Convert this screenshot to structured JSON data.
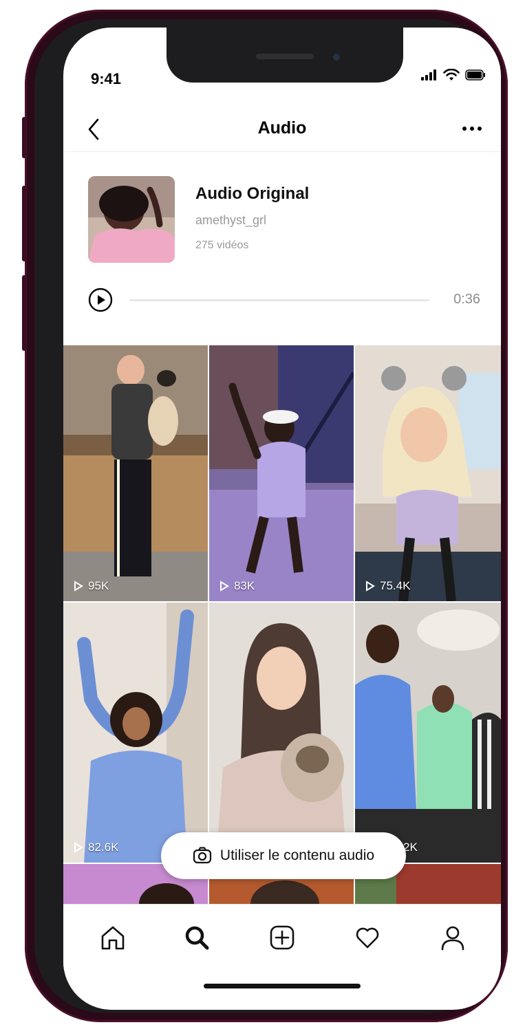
{
  "status_bar": {
    "time": "9:41"
  },
  "nav": {
    "title": "Audio"
  },
  "audio": {
    "title": "Audio Original",
    "author": "amethyst_grl",
    "videos": "275 vidéos",
    "duration": "0:36",
    "progress": 0
  },
  "grid": {
    "tiles": [
      {
        "count": "95K"
      },
      {
        "count": "83K"
      },
      {
        "count": "75.4K"
      },
      {
        "count": "82.6K"
      },
      {
        "count": ""
      },
      {
        "count": "2K"
      }
    ]
  },
  "action": {
    "use_audio_label": "Utiliser le contenu audio"
  },
  "tabbar": {
    "icons": [
      "home-icon",
      "search-icon",
      "create-icon",
      "activity-heart-icon",
      "profile-icon"
    ]
  },
  "colors": {
    "accent": "#262626",
    "muted": "#9a9a9a",
    "frame": "#2a0a18"
  }
}
